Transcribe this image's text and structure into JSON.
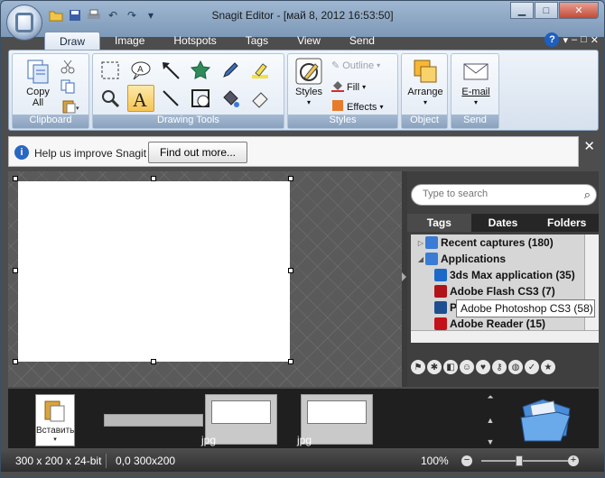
{
  "window": {
    "title": "Snagit Editor - [май 8, 2012 16:53:50]",
    "min_glyph": "▁",
    "max_glyph": "□",
    "close_glyph": "✕"
  },
  "tabs": [
    "Draw",
    "Image",
    "Hotspots",
    "Tags",
    "View",
    "Send"
  ],
  "tab_right": {
    "help": "?",
    "min": "–",
    "restore": "□",
    "close": "✕"
  },
  "ribbon": {
    "clipboard": {
      "copy_all_line1": "Copy",
      "copy_all_line2": "All",
      "label": "Clipboard"
    },
    "drawing_tools": {
      "label": "Drawing Tools"
    },
    "styles": {
      "styles_label": "Styles",
      "outline": "Outline",
      "fill": "Fill",
      "effects": "Effects",
      "label": "Styles"
    },
    "object": {
      "arrange": "Arrange",
      "label": "Object"
    },
    "send": {
      "email": "E-mail",
      "label": "Send"
    }
  },
  "infobar": {
    "text": "Help us improve Snagit",
    "button": "Find out more..."
  },
  "search": {
    "placeholder": "Type to search"
  },
  "right_tabs": [
    "Tags",
    "Dates",
    "Folders"
  ],
  "tree": [
    {
      "label": "Recent captures (180)",
      "indent": 0,
      "expander": "▷",
      "icon_color": "#3a7bd5"
    },
    {
      "label": "Applications",
      "indent": 0,
      "expander": "◢",
      "icon_color": "#3a7bd5"
    },
    {
      "label": "3ds Max application (35)",
      "indent": 1,
      "expander": "",
      "icon_color": "#1b6ac9"
    },
    {
      "label": "Adobe Flash CS3 (7)",
      "indent": 1,
      "expander": "",
      "icon_color": "#b0141a"
    },
    {
      "label": "Ps",
      "indent": 1,
      "expander": "",
      "icon_color": "#1d4f91"
    },
    {
      "label": "Adobe Reader  (15)",
      "indent": 1,
      "expander": "",
      "icon_color": "#c4121a"
    }
  ],
  "tooltip": "Adobe Photoshop CS3 (58)",
  "tray": {
    "paste_label": "Вставить",
    "thumb1_label": "jpg",
    "thumb2_label": "jpg"
  },
  "statusbar": {
    "dims": "300 x 200 x 24-bit",
    "coords": "0,0  300x200",
    "zoom": "100%"
  },
  "zoom_level_percent": 100,
  "colors": {
    "accent": "#f6c555",
    "panel": "#3f3f3f",
    "ribbon_label": "#8aa2bf"
  }
}
